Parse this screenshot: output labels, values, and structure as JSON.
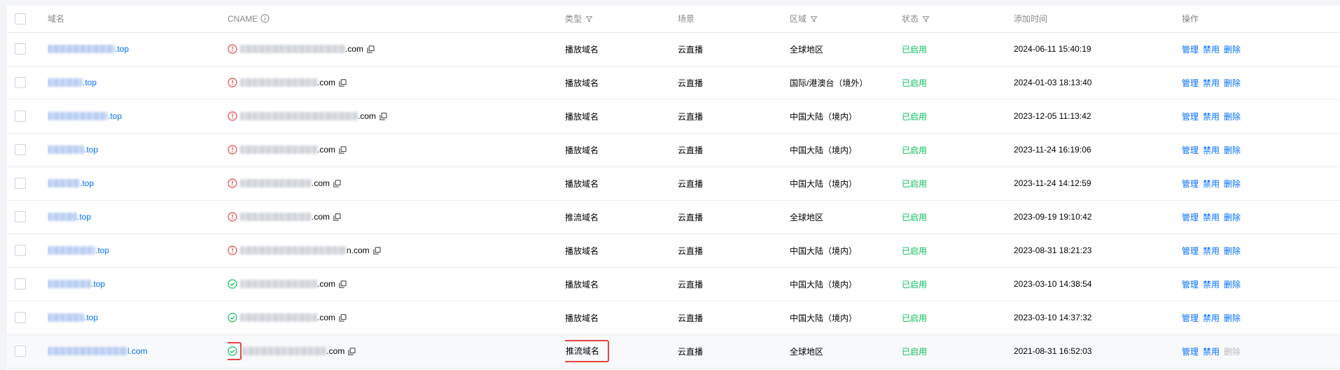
{
  "headers": {
    "domain": "域名",
    "cname": "CNAME",
    "type": "类型",
    "scene": "场景",
    "region": "区域",
    "status": "状态",
    "added_time": "添加时间",
    "ops": "操作"
  },
  "colors": {
    "link": "#006eff",
    "error": "#e54545",
    "ok": "#0abf5b",
    "disabled": "#bbbbbb"
  },
  "ops_labels": {
    "manage": "管理",
    "disable": "禁用",
    "delete": "删除"
  },
  "rows": [
    {
      "domain_suffix": ".top",
      "cname_suffix": ".com",
      "cname_state": "error-icon",
      "type": "播放域名",
      "scene": "云直播",
      "region": "全球地区",
      "status": "已启用",
      "time": "2024-06-11 15:40:19"
    },
    {
      "domain_suffix": ".top",
      "cname_suffix": ".com",
      "cname_state": "error-icon",
      "type": "播放域名",
      "scene": "云直播",
      "region": "国际/港澳台（境外）",
      "status": "已启用",
      "time": "2024-01-03 18:13:40"
    },
    {
      "domain_suffix": ".top",
      "cname_suffix": ".com",
      "cname_state": "error-icon",
      "type": "播放域名",
      "scene": "云直播",
      "region": "中国大陆（境内）",
      "status": "已启用",
      "time": "2023-12-05 11:13:42"
    },
    {
      "domain_suffix": ".top",
      "cname_suffix": ".com",
      "cname_state": "error-icon",
      "type": "播放域名",
      "scene": "云直播",
      "region": "中国大陆（境内）",
      "status": "已启用",
      "time": "2023-11-24 16:19:06"
    },
    {
      "domain_suffix": ".top",
      "cname_suffix": ".com",
      "cname_state": "error-icon",
      "type": "播放域名",
      "scene": "云直播",
      "region": "中国大陆（境内）",
      "status": "已启用",
      "time": "2023-11-24 14:12:59"
    },
    {
      "domain_suffix": ".top",
      "cname_suffix": ".com",
      "cname_state": "error-icon",
      "type": "推流域名",
      "scene": "云直播",
      "region": "全球地区",
      "status": "已启用",
      "time": "2023-09-19 19:10:42"
    },
    {
      "domain_suffix": ".top",
      "cname_suffix": "n.com",
      "cname_state": "error-icon",
      "type": "播放域名",
      "scene": "云直播",
      "region": "中国大陆（境内）",
      "status": "已启用",
      "time": "2023-08-31 18:21:23"
    },
    {
      "domain_suffix": ".top",
      "cname_suffix": ".com",
      "cname_state": "check-icon",
      "type": "播放域名",
      "scene": "云直播",
      "region": "中国大陆（境内）",
      "status": "已启用",
      "time": "2023-03-10 14:38:54"
    },
    {
      "domain_suffix": ".top",
      "cname_suffix": ".com",
      "cname_state": "check-icon",
      "type": "播放域名",
      "scene": "云直播",
      "region": "中国大陆（境内）",
      "status": "已启用",
      "time": "2023-03-10 14:37:32"
    },
    {
      "domain_suffix": "l.com",
      "cname_suffix": ".com",
      "cname_state": "check-icon",
      "type": "推流域名",
      "scene": "云直播",
      "region": "全球地区",
      "status": "已启用",
      "time": "2021-08-31 16:52:03"
    }
  ]
}
